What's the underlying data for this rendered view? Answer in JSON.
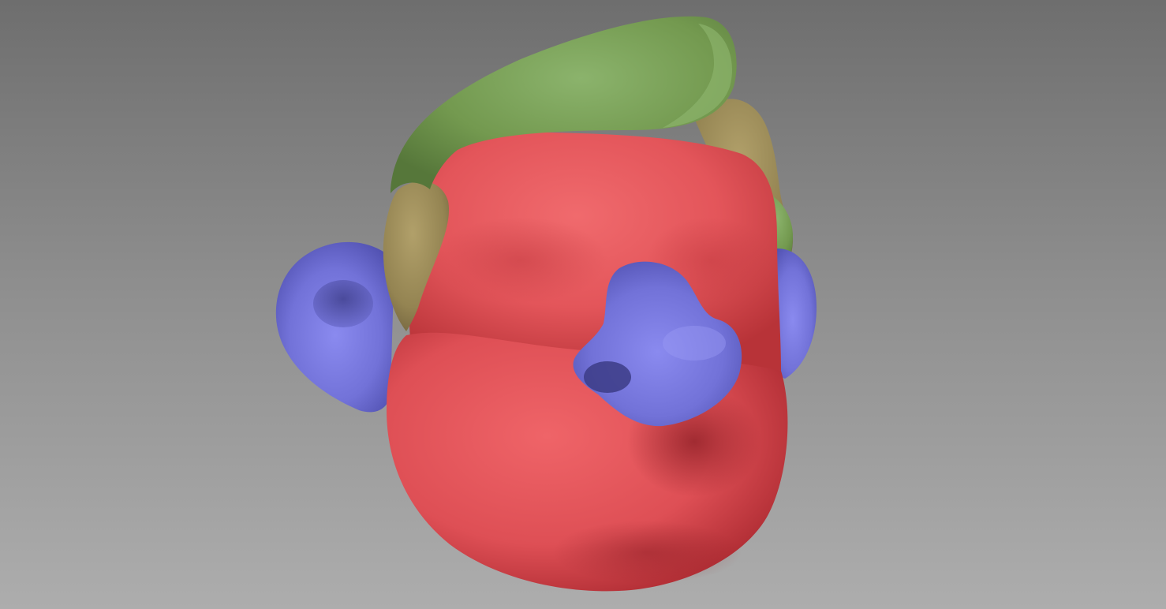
{
  "viewport": {
    "background_top": "#6e6e6e",
    "background_bottom": "#adadad"
  },
  "model": {
    "polygroups": [
      {
        "name": "head",
        "color": "#e3555a"
      },
      {
        "name": "hair",
        "color": "#77a05a"
      },
      {
        "name": "sideburn",
        "color": "#9a8a58"
      },
      {
        "name": "ear-left",
        "color": "#7474d6"
      },
      {
        "name": "ear-right",
        "color": "#7474d6"
      },
      {
        "name": "nose",
        "color": "#7474d6"
      }
    ]
  }
}
